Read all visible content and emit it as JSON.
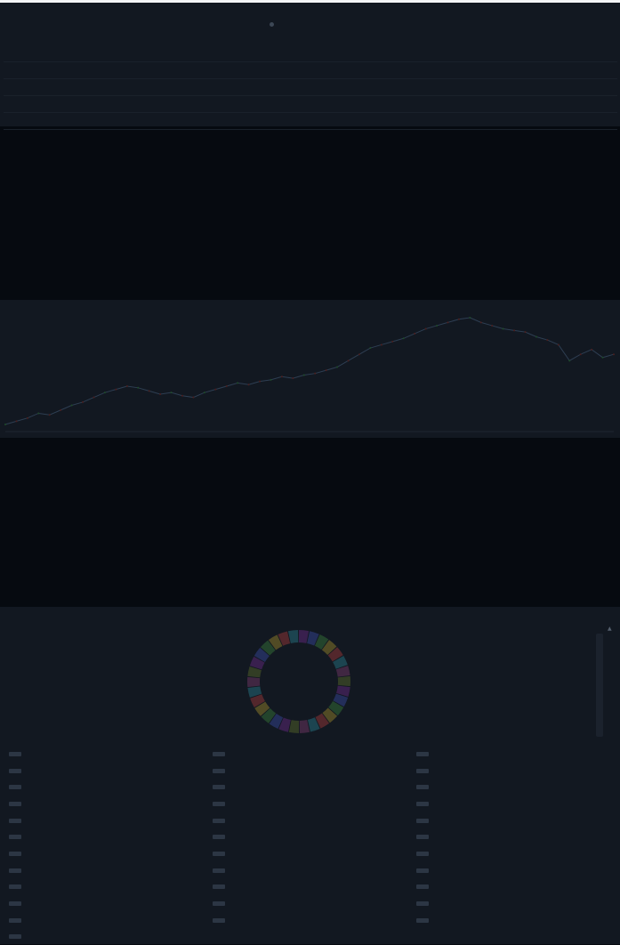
{
  "window": {
    "title": "",
    "top_text": ""
  },
  "panel_top": {
    "header_button": "",
    "title": "",
    "columns": [
      "",
      "",
      "",
      "",
      "",
      ""
    ],
    "rows": [
      [
        "",
        "",
        "",
        "",
        "",
        ""
      ],
      [
        "",
        "",
        "",
        "",
        "",
        ""
      ],
      [
        "",
        "",
        "",
        "",
        "",
        ""
      ],
      [
        "",
        "",
        "",
        "",
        "",
        ""
      ]
    ]
  },
  "panel_chart": {
    "legend": [
      "",
      "",
      ""
    ],
    "subtitle": ""
  },
  "chart_data": {
    "type": "line",
    "series": [
      {
        "values": [
          18,
          20,
          22,
          25,
          24,
          27,
          30,
          32,
          35,
          38,
          40,
          42,
          41,
          39,
          37,
          38,
          36,
          35,
          38,
          40,
          42,
          44,
          43,
          45,
          46,
          48,
          47,
          49,
          50,
          52,
          54,
          58,
          62,
          66,
          68,
          70,
          72,
          75,
          78,
          80,
          82,
          84,
          85,
          82,
          80,
          78,
          77,
          76,
          73,
          71,
          68,
          58,
          62,
          65,
          60,
          62
        ]
      }
    ],
    "grid": false,
    "legend": "top-left"
  },
  "panel_donut": {
    "title": "",
    "center_line1": "",
    "center_line2": "",
    "segment_count": 30,
    "colors": [
      "#6b2b86",
      "#3a4aa0",
      "#3a7b3a",
      "#a08a2a",
      "#a33a3a",
      "#2a7b8a",
      "#7a3a6a",
      "#5a6a2a"
    ],
    "grid_items": [
      "",
      "",
      "",
      "",
      "",
      "",
      "",
      "",
      "",
      "",
      "",
      "",
      "",
      "",
      "",
      "",
      "",
      "",
      "",
      "",
      "",
      "",
      "",
      "",
      "",
      "",
      "",
      "",
      "",
      "",
      "",
      "",
      "",
      ""
    ]
  },
  "icons": {
    "scroll_up": "triangle-up-icon"
  }
}
